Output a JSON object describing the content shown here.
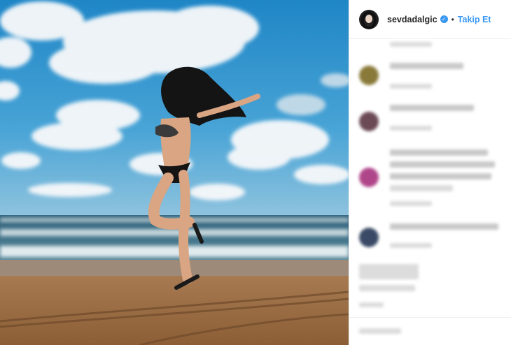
{
  "header": {
    "username": "sevdadalgic",
    "separator": "•",
    "follow_label": "Takip Et",
    "verified_mark": "✓",
    "avatar_icon": "profile-avatar"
  },
  "colors": {
    "link_blue": "#3897f0",
    "username_text": "#262626",
    "divider": "#efefef",
    "sky": "#2f8fc8",
    "sea": "#3f6f86",
    "sand": "#b07a4a"
  },
  "comments_blurred": true
}
